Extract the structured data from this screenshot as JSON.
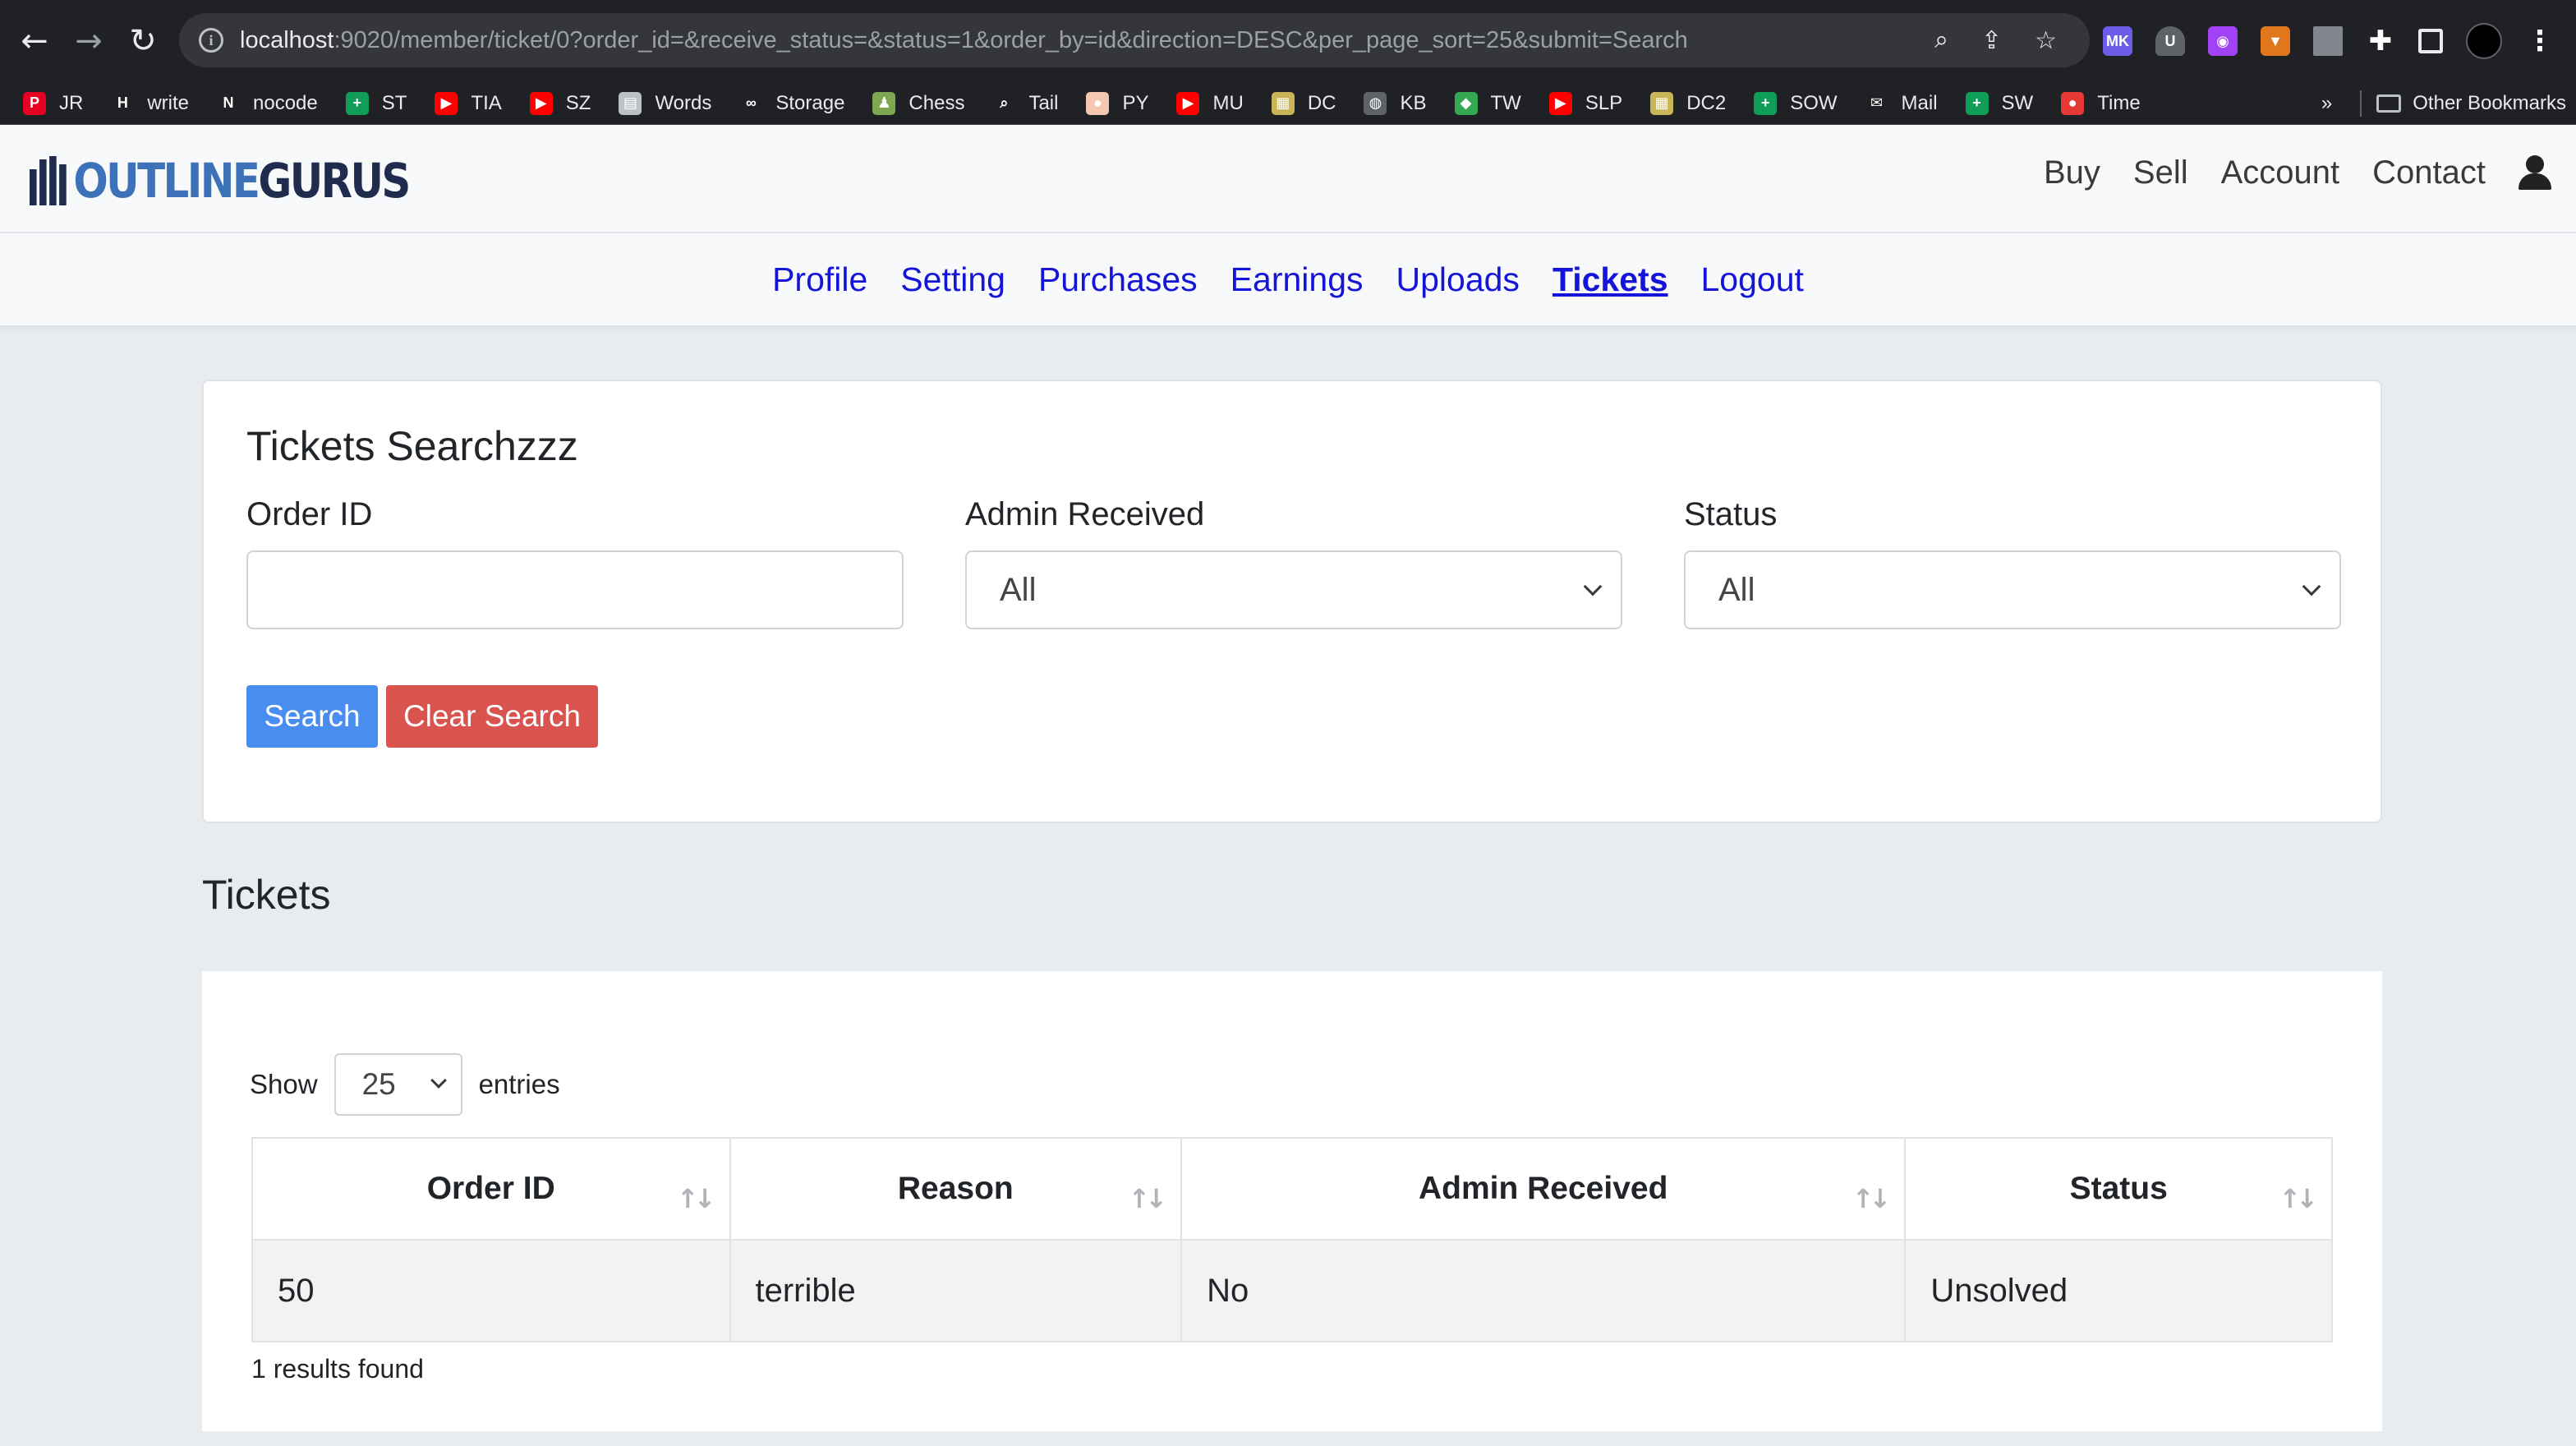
{
  "browser": {
    "url_host": "localhost",
    "url_rest": ":9020/member/ticket/0?order_id=&receive_status=&status=1&order_by=id&direction=DESC&per_page_sort=25&submit=Search",
    "bookmarks": [
      {
        "label": "JR",
        "icon": "pinterest-icon",
        "color": "#e60023",
        "glyph": "P"
      },
      {
        "label": "write",
        "icon": "hashnode-icon",
        "color": "#202124",
        "glyph": "H"
      },
      {
        "label": "nocode",
        "icon": "nocode-icon",
        "color": "#202124",
        "glyph": "N"
      },
      {
        "label": "ST",
        "icon": "sheets-icon",
        "color": "#0f9d58",
        "glyph": "+"
      },
      {
        "label": "TIA",
        "icon": "youtube-icon",
        "color": "#ff0000",
        "glyph": "▶"
      },
      {
        "label": "SZ",
        "icon": "youtube-icon",
        "color": "#ff0000",
        "glyph": "▶"
      },
      {
        "label": "Words",
        "icon": "document-icon",
        "color": "#bdc1c6",
        "glyph": "▤"
      },
      {
        "label": "Storage",
        "icon": "infinity-icon",
        "color": "#202124",
        "glyph": "∞"
      },
      {
        "label": "Chess",
        "icon": "chess-pawn-icon",
        "color": "#7fa650",
        "glyph": "♟"
      },
      {
        "label": "Tail",
        "icon": "search-icon",
        "color": "#202124",
        "glyph": "⌕"
      },
      {
        "label": "PY",
        "icon": "py-icon",
        "color": "#f4c7b0",
        "glyph": "●"
      },
      {
        "label": "MU",
        "icon": "youtube-icon",
        "color": "#ff0000",
        "glyph": "▶"
      },
      {
        "label": "DC",
        "icon": "map-icon",
        "color": "#c9b458",
        "glyph": "▦"
      },
      {
        "label": "KB",
        "icon": "globe-icon",
        "color": "#5f6368",
        "glyph": "◍"
      },
      {
        "label": "TW",
        "icon": "tw-icon",
        "color": "#34a853",
        "glyph": "◆"
      },
      {
        "label": "SLP",
        "icon": "youtube-icon",
        "color": "#ff0000",
        "glyph": "▶"
      },
      {
        "label": "DC2",
        "icon": "map-icon",
        "color": "#c9b458",
        "glyph": "▦"
      },
      {
        "label": "SOW",
        "icon": "sheets-icon",
        "color": "#0f9d58",
        "glyph": "+"
      },
      {
        "label": "Mail",
        "icon": "mail-icon",
        "color": "#202124",
        "glyph": "✉"
      },
      {
        "label": "SW",
        "icon": "sheets-icon",
        "color": "#0f9d58",
        "glyph": "+"
      },
      {
        "label": "Time",
        "icon": "tomato-icon",
        "color": "#e53935",
        "glyph": "●"
      }
    ],
    "more_bookmarks": "»",
    "other_bookmarks": "Other Bookmarks"
  },
  "header": {
    "logo_outline": "OUTLINE",
    "logo_gurus": "GURUS",
    "nav": [
      "Buy",
      "Sell",
      "Account",
      "Contact"
    ]
  },
  "member_nav": [
    {
      "label": "Profile",
      "active": false
    },
    {
      "label": "Setting",
      "active": false
    },
    {
      "label": "Purchases",
      "active": false
    },
    {
      "label": "Earnings",
      "active": false
    },
    {
      "label": "Uploads",
      "active": false
    },
    {
      "label": "Tickets",
      "active": true
    },
    {
      "label": "Logout",
      "active": false
    }
  ],
  "search": {
    "title": "Tickets Searchzzz",
    "order_id_label": "Order ID",
    "order_id_value": "",
    "admin_received_label": "Admin Received",
    "admin_received_value": "All",
    "status_label": "Status",
    "status_value": "All",
    "search_button": "Search",
    "clear_button": "Clear Search"
  },
  "tickets": {
    "title": "Tickets",
    "show_label": "Show",
    "entries_label": "entries",
    "per_page": "25",
    "columns": [
      "Order ID",
      "Reason",
      "Admin Received",
      "Status"
    ],
    "rows": [
      [
        "50",
        "terrible",
        "No",
        "Unsolved"
      ]
    ],
    "results_text": "1 results found"
  },
  "colors": {
    "link": "#1515d8",
    "search_button": "#4a8df0",
    "clear_button": "#d9534f",
    "logo_blue": "#3e72b8",
    "logo_navy": "#1f2c4d"
  }
}
